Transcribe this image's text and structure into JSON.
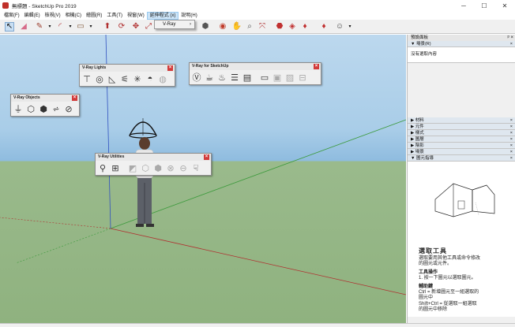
{
  "window": {
    "title": "無標題 - SketchUp Pro 2019",
    "minimize": "─",
    "maximize": "☐",
    "close": "✕"
  },
  "menubar": {
    "items": [
      {
        "label": "檔案(F)"
      },
      {
        "label": "編輯(E)"
      },
      {
        "label": "檢視(V)"
      },
      {
        "label": "相機(C)"
      },
      {
        "label": "繪圖(R)"
      },
      {
        "label": "工具(T)"
      },
      {
        "label": "視窗(W)"
      },
      {
        "label": "延伸程式 (x)",
        "active": true
      },
      {
        "label": "說明(H)"
      }
    ]
  },
  "dropdown": {
    "item_label": "V-Ray",
    "arrow": "›"
  },
  "panels": {
    "lights": {
      "title": "V-Ray Lights",
      "close": "×"
    },
    "sketchup": {
      "title": "V-Ray for SketchUp",
      "close": "×"
    },
    "objects": {
      "title": "V-Ray Objects",
      "close": "×"
    },
    "utilities": {
      "title": "V-Ray Utilities",
      "close": "×"
    }
  },
  "tray": {
    "title": "預設面板",
    "pin": "ᵖ ×",
    "scenes_open": "▼ 場景(R)",
    "scene_box": "沒有選取內容",
    "sections": [
      {
        "label": "▶ 材料"
      },
      {
        "label": "▶ 元件"
      },
      {
        "label": "▶ 樣式"
      },
      {
        "label": "▶ 圖層"
      },
      {
        "label": "▶ 陰影"
      },
      {
        "label": "▶ 場景"
      }
    ],
    "instructor_label": "▼ 圖元指導",
    "instructor": {
      "heading": "選取工具",
      "desc1": "選取要用其他工具或命令修改",
      "desc2": "的圖元或元件。",
      "ops_heading": "工具操作",
      "ops1": "1.  按一下圖元以選取圖元。",
      "mods_heading": "輔助鍵",
      "mod1": "Ctrl = 新增圖元至一組選取的",
      "mod1b": "圖元中",
      "mod2": "Shift+Ctrl = 從選取一組選取",
      "mod2b": "的圖元中移除"
    }
  },
  "icons": {
    "select": "↖",
    "eraser": "◢",
    "pencil": "✎",
    "arc": "◜",
    "rect": "▭",
    "push": "⬆",
    "move": "✥",
    "rotate": "⟳",
    "scale": "⤢",
    "offset": "◎",
    "tape": "⌂",
    "paint": "⬢",
    "orbit": "◉",
    "pan": "✋",
    "zoom": "⌕",
    "zoomext": "⤧",
    "warehouse": "⬣",
    "extension": "◈",
    "ruby": "♦",
    "account": "☺"
  }
}
